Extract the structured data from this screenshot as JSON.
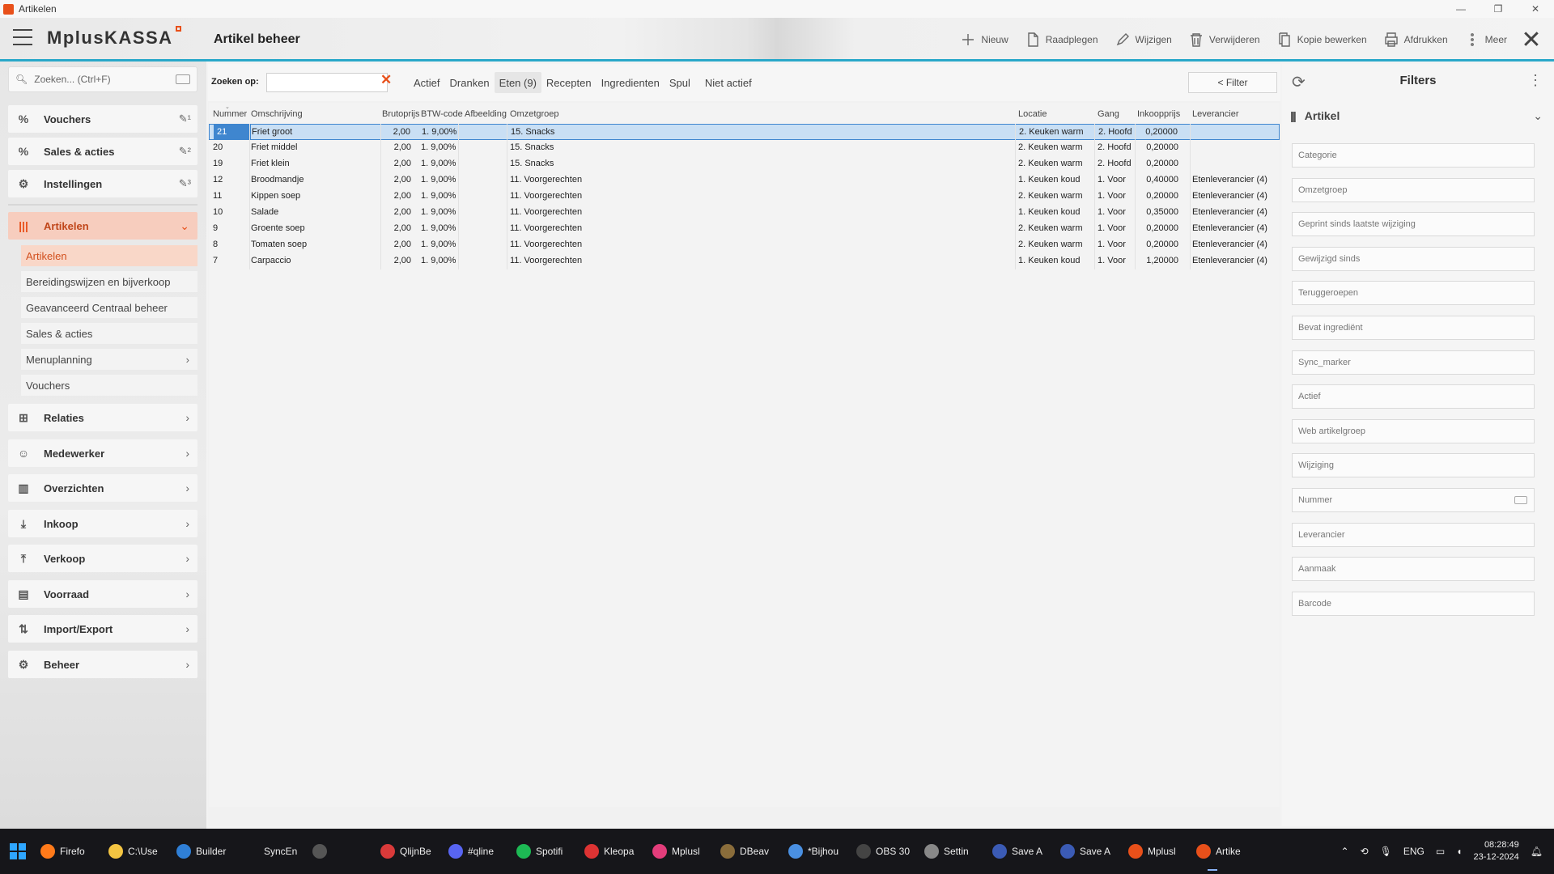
{
  "window": {
    "title": "Artikelen",
    "controls": [
      "—",
      "❐",
      "✕"
    ]
  },
  "app": {
    "logo": "MplusKASSA",
    "page_title": "Artikel beheer"
  },
  "toolbar": {
    "buttons": [
      {
        "label": "Nieuw",
        "icon": "plus-icon"
      },
      {
        "label": "Raadplegen",
        "icon": "document-icon"
      },
      {
        "label": "Wijzigen",
        "icon": "pencil-icon"
      },
      {
        "label": "Verwijderen",
        "icon": "trash-icon"
      },
      {
        "label": "Kopie bewerken",
        "icon": "copy-icon"
      },
      {
        "label": "Afdrukken",
        "icon": "printer-icon"
      },
      {
        "label": "Meer",
        "icon": "more-vertical-icon"
      }
    ],
    "close": "✕"
  },
  "sidebar": {
    "search_placeholder": "Zoeken... (Ctrl+F)",
    "pinned": [
      {
        "label": "Vouchers",
        "icon": "%",
        "pin": "✎¹"
      },
      {
        "label": "Sales & acties",
        "icon": "%",
        "pin": "✎²"
      },
      {
        "label": "Instellingen",
        "icon": "⚙",
        "pin": "✎³"
      }
    ],
    "sections": [
      {
        "label": "Artikelen",
        "icon": "|||",
        "chev": "⌄"
      },
      {
        "label": "Relaties",
        "icon": "⊞",
        "chev": "›"
      },
      {
        "label": "Medewerker",
        "icon": "☺",
        "chev": "›"
      },
      {
        "label": "Overzichten",
        "icon": "▥",
        "chev": "›"
      },
      {
        "label": "Inkoop",
        "icon": "⤓",
        "chev": "›"
      },
      {
        "label": "Verkoop",
        "icon": "⤒",
        "chev": "›"
      },
      {
        "label": "Voorraad",
        "icon": "▤",
        "chev": "›"
      },
      {
        "label": "Import/Export",
        "icon": "⇅",
        "chev": "›"
      },
      {
        "label": "Beheer",
        "icon": "⚙",
        "chev": "›"
      }
    ],
    "sub_items": [
      {
        "label": "Artikelen"
      },
      {
        "label": "Bereidingswijzen en bijverkoop"
      },
      {
        "label": "Geavanceerd Centraal beheer"
      },
      {
        "label": "Sales & acties"
      },
      {
        "label": "Menuplanning",
        "chev": "›"
      },
      {
        "label": "Vouchers"
      }
    ]
  },
  "search": {
    "label": "Zoeken op:",
    "value": "",
    "clear": "✕"
  },
  "tabs": [
    "Actief",
    "Dranken",
    "Eten (9)",
    "Recepten",
    "Ingredienten",
    "Spul",
    "Niet actief"
  ],
  "active_tab": "Eten (9)",
  "filter_button": "< Filter",
  "table": {
    "columns": [
      "Nummer",
      "Omschrijving",
      "Brutoprijs",
      "BTW-code",
      "Afbeelding",
      "Omzetgroep",
      "Locatie",
      "Gang",
      "Inkoopprijs",
      "Leverancier"
    ],
    "rows": [
      [
        "21",
        "Friet groot",
        "2,00",
        "1. 9,00%",
        "",
        "15. Snacks",
        "2. Keuken warm",
        "2. Hoofd",
        "0,20000",
        ""
      ],
      [
        "20",
        "Friet middel",
        "2,00",
        "1. 9,00%",
        "",
        "15. Snacks",
        "2. Keuken warm",
        "2. Hoofd",
        "0,20000",
        ""
      ],
      [
        "19",
        "Friet klein",
        "2,00",
        "1. 9,00%",
        "",
        "15. Snacks",
        "2. Keuken warm",
        "2. Hoofd",
        "0,20000",
        ""
      ],
      [
        "12",
        "Broodmandje",
        "2,00",
        "1. 9,00%",
        "",
        "11. Voorgerechten",
        "1. Keuken koud",
        "1. Voor",
        "0,40000",
        "Etenleverancier (4)"
      ],
      [
        "11",
        "Kippen soep",
        "2,00",
        "1. 9,00%",
        "",
        "11. Voorgerechten",
        "2. Keuken warm",
        "1. Voor",
        "0,20000",
        "Etenleverancier (4)"
      ],
      [
        "10",
        "Salade",
        "2,00",
        "1. 9,00%",
        "",
        "11. Voorgerechten",
        "1. Keuken koud",
        "1. Voor",
        "0,35000",
        "Etenleverancier (4)"
      ],
      [
        "9",
        "Groente soep",
        "2,00",
        "1. 9,00%",
        "",
        "11. Voorgerechten",
        "2. Keuken warm",
        "1. Voor",
        "0,20000",
        "Etenleverancier (4)"
      ],
      [
        "8",
        "Tomaten soep",
        "2,00",
        "1. 9,00%",
        "",
        "11. Voorgerechten",
        "2. Keuken warm",
        "1. Voor",
        "0,20000",
        "Etenleverancier (4)"
      ],
      [
        "7",
        "Carpaccio",
        "2,00",
        "1. 9,00%",
        "",
        "11. Voorgerechten",
        "1. Keuken koud",
        "1. Voor",
        "1,20000",
        "Etenleverancier (4)"
      ]
    ],
    "selected_row": 0
  },
  "filters": {
    "title": "Filters",
    "section": "Artikel",
    "fields": [
      "Categorie",
      "Omzetgroep",
      "Geprint sinds laatste wijziging",
      "Gewijzigd sinds",
      "Teruggeroepen",
      "Bevat ingrediënt",
      "Sync_marker",
      "Actief",
      "Web artikelgroep",
      "Wijziging",
      "Nummer",
      "Leverancier",
      "Aanmaak",
      "Barcode"
    ]
  },
  "taskbar": {
    "apps": [
      {
        "label": "Firefo",
        "color": "#ff7a1a"
      },
      {
        "label": "C:\\Use",
        "color": "#f4c542"
      },
      {
        "label": "Builder",
        "color": "#2f7fd6"
      },
      {
        "label": "SyncEn",
        "color": "#16161a"
      },
      {
        "label": "",
        "color": "#555"
      },
      {
        "label": "QlijnBe",
        "color": "#d93a3a"
      },
      {
        "label": "#qline",
        "color": "#5865f2"
      },
      {
        "label": "Spotifi",
        "color": "#1db954"
      },
      {
        "label": "Kleopa",
        "color": "#d33"
      },
      {
        "label": "Mplusl",
        "color": "#e33d7b"
      },
      {
        "label": "DBeav",
        "color": "#8a6d3b"
      },
      {
        "label": "*Bijhou",
        "color": "#4a90e2"
      },
      {
        "label": "OBS 30",
        "color": "#444"
      },
      {
        "label": "Settin",
        "color": "#888"
      },
      {
        "label": "Save A",
        "color": "#3b5bb5"
      },
      {
        "label": "Save A",
        "color": "#3b5bb5"
      },
      {
        "label": "Mplusl",
        "color": "#e8501a"
      },
      {
        "label": "Artike",
        "color": "#e8501a"
      }
    ],
    "lang": "ENG",
    "time": "08:28:49",
    "date": "23-12-2024"
  }
}
